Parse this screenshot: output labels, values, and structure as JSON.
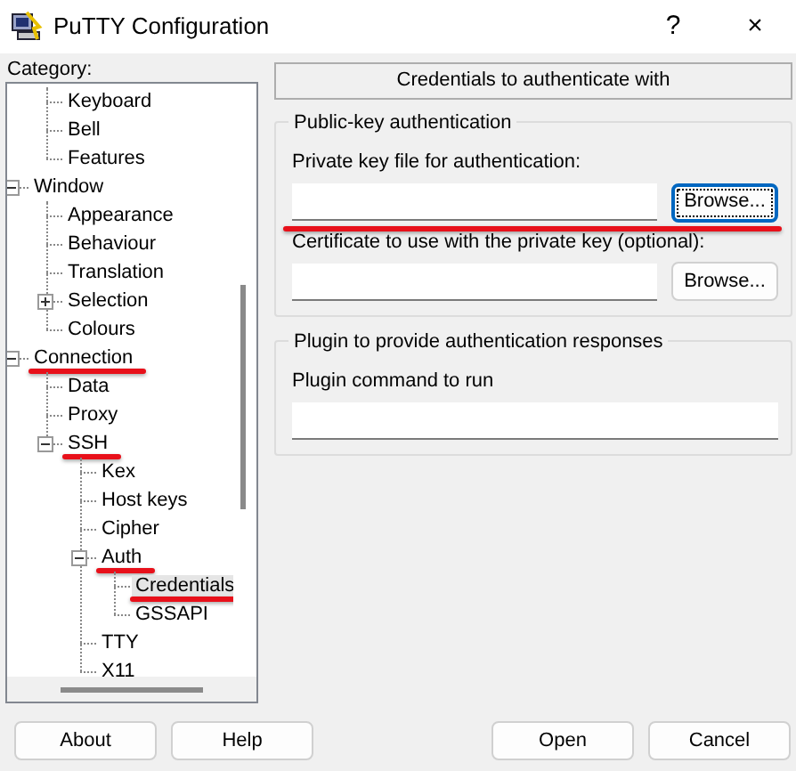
{
  "window": {
    "title": "PuTTY Configuration",
    "help": "?",
    "close": "×"
  },
  "category_label": "Category:",
  "tree": {
    "items": [
      {
        "children": [
          {
            "label": "Keyboard",
            "selected": false,
            "annotated": false
          },
          {
            "label": "Bell",
            "selected": false,
            "annotated": false
          },
          {
            "label": "Features",
            "selected": false,
            "annotated": false
          }
        ]
      },
      {
        "label": "Window",
        "selected": false,
        "annotated": false,
        "expanded": true,
        "children": [
          {
            "label": "Appearance",
            "selected": false,
            "annotated": false
          },
          {
            "label": "Behaviour",
            "selected": false,
            "annotated": false
          },
          {
            "label": "Translation",
            "selected": false,
            "annotated": false
          },
          {
            "label": "Selection",
            "selected": false,
            "annotated": false,
            "expanded": false,
            "has_children": true
          },
          {
            "label": "Colours",
            "selected": false,
            "annotated": false
          }
        ]
      },
      {
        "label": "Connection",
        "selected": false,
        "annotated": true,
        "expanded": true,
        "children": [
          {
            "label": "Data",
            "selected": false,
            "annotated": false
          },
          {
            "label": "Proxy",
            "selected": false,
            "annotated": false
          },
          {
            "label": "SSH",
            "selected": false,
            "annotated": true,
            "expanded": true,
            "children": [
              {
                "label": "Kex",
                "selected": false,
                "annotated": false
              },
              {
                "label": "Host keys",
                "selected": false,
                "annotated": false
              },
              {
                "label": "Cipher",
                "selected": false,
                "annotated": false
              },
              {
                "label": "Auth",
                "selected": false,
                "annotated": true,
                "expanded": true,
                "children": [
                  {
                    "label": "Credentials",
                    "selected": true,
                    "annotated": true
                  },
                  {
                    "label": "GSSAPI",
                    "selected": false,
                    "annotated": false
                  }
                ]
              },
              {
                "label": "TTY",
                "selected": false,
                "annotated": false
              },
              {
                "label": "X11",
                "selected": false,
                "annotated": false
              }
            ]
          }
        ]
      }
    ]
  },
  "panel": {
    "header": "Credentials to authenticate with",
    "groups": [
      {
        "title": "Public-key authentication",
        "fields": [
          {
            "label": "Private key file for authentication:",
            "button": "Browse...",
            "focused": true,
            "annotated": true
          },
          {
            "label": "Certificate to use with the private key (optional):",
            "button": "Browse...",
            "focused": false,
            "annotated": false
          }
        ]
      },
      {
        "title": "Plugin to provide authentication responses",
        "fields": [
          {
            "label": "Plugin command to run",
            "annotated": false
          }
        ]
      }
    ]
  },
  "buttons_left": [
    "About",
    "Help"
  ],
  "buttons_right": [
    "Open",
    "Cancel"
  ]
}
